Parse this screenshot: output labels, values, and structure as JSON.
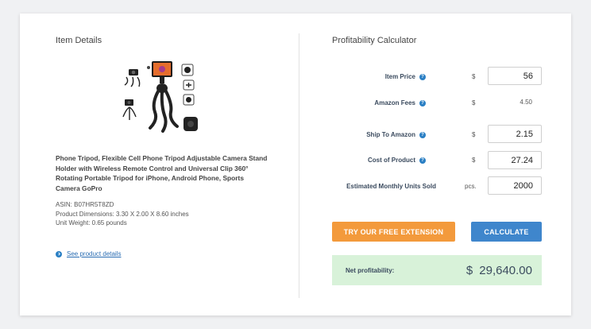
{
  "item_details": {
    "title": "Item Details",
    "product_name": "Phone Tripod, Flexible Cell Phone Tripod Adjustable Camera Stand Holder with Wireless Remote Control and Universal Clip 360° Rotating Portable Tripod for iPhone, Android Phone, Sports Camera GoPro",
    "asin": "ASIN: B07HR5T8ZD",
    "dimensions": "Product Dimensions: 3.30 X 2.00 X 8.60 inches",
    "weight": "Unit Weight: 0.65 pounds",
    "details_link": "See product details"
  },
  "calculator": {
    "title": "Profitability Calculator",
    "item_price_label": "Item Price",
    "item_price_unit": "$",
    "item_price_value": "56",
    "amazon_fees_label": "Amazon Fees",
    "amazon_fees_unit": "$",
    "amazon_fees_value": "4.50",
    "ship_label": "Ship To Amazon",
    "ship_unit": "$",
    "ship_value": "2.15",
    "cost_label": "Cost of Product",
    "cost_unit": "$",
    "cost_value": "27.24",
    "units_label": "Estimated Monthly Units Sold",
    "units_unit": "pcs.",
    "units_value": "2000",
    "help_glyph": "?",
    "extension_button": "TRY OUR FREE EXTENSION",
    "calculate_button": "CALCULATE",
    "net_label": "Net profitability:",
    "net_currency": "$",
    "net_value": "29,640.00"
  },
  "colors": {
    "accent_blue": "#3f86cc",
    "accent_orange": "#f39a3c",
    "result_bg": "#d8f2d9"
  },
  "icons": [
    "help-icon",
    "chevron-right-icon"
  ]
}
